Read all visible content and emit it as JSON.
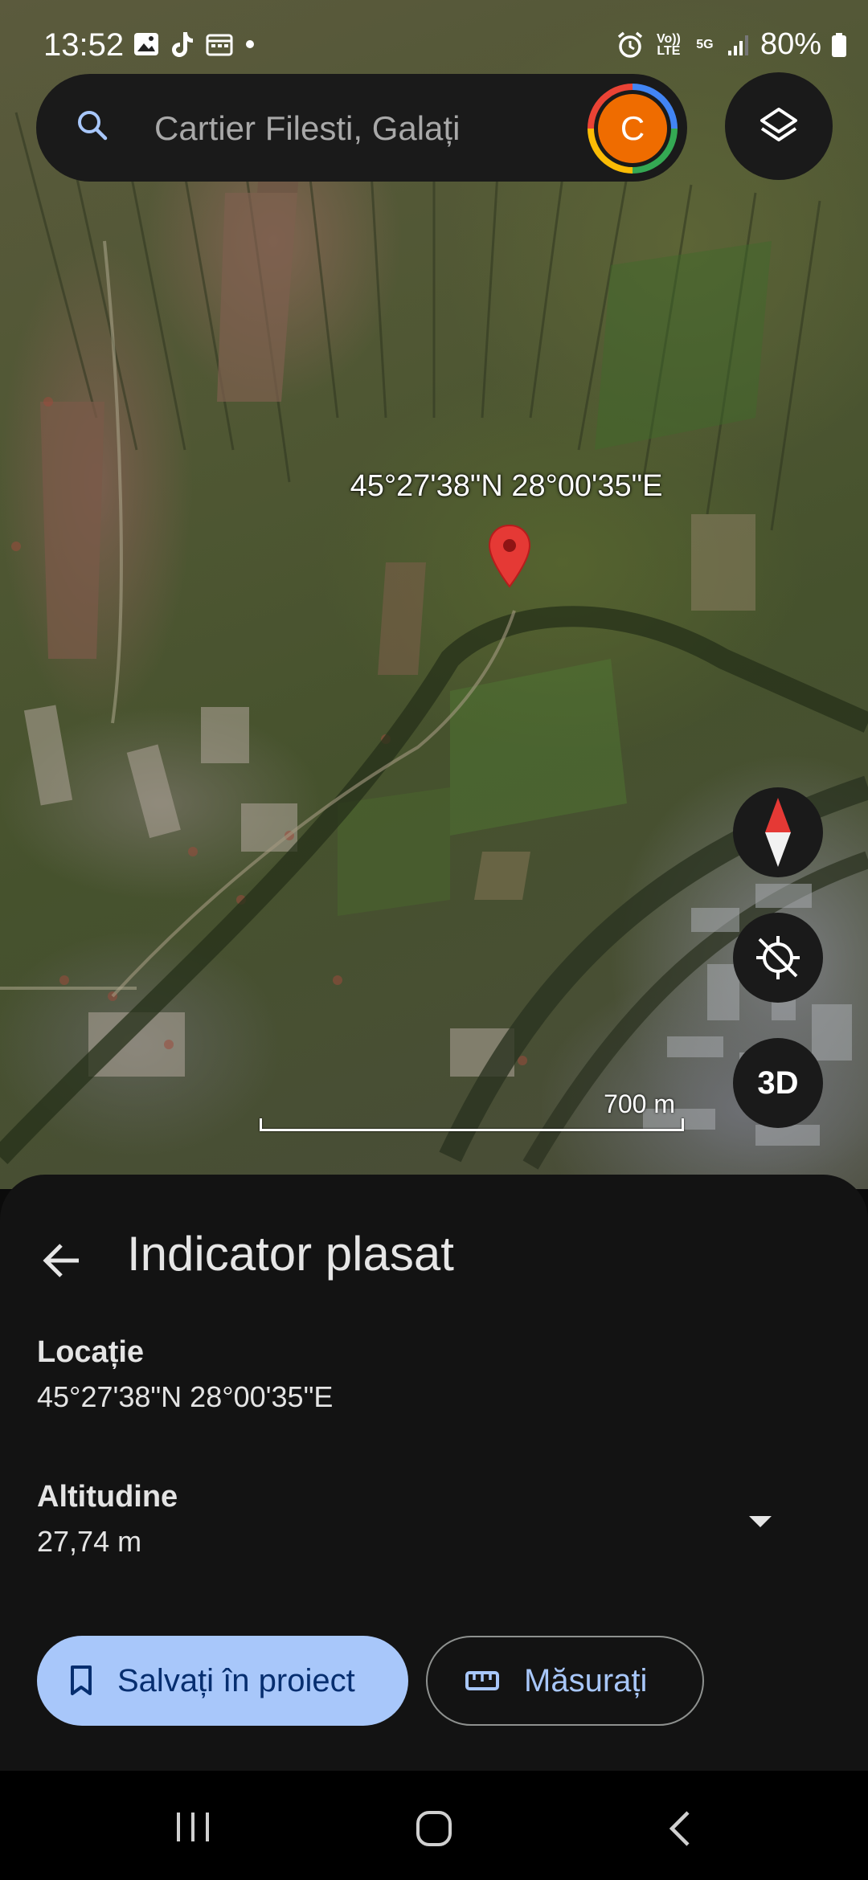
{
  "status_bar": {
    "time": "13:52",
    "battery": "80%",
    "volte": "Vo)) LTE",
    "network": "5G"
  },
  "search": {
    "placeholder": "Cartier Filesti, Galați",
    "avatar_letter": "C"
  },
  "map": {
    "pin_coordinates": "45°27'38\"N 28°00'35\"E",
    "scale_label": "700 m",
    "button_3d": "3D"
  },
  "sheet": {
    "title": "Indicator plasat",
    "location_label": "Locație",
    "location_value": "45°27'38\"N 28°00'35\"E",
    "altitude_label": "Altitudine",
    "altitude_value": "27,74 m",
    "save_button": "Salvați în proiect",
    "measure_button": "Măsurați"
  },
  "colors": {
    "sheet_bg": "#131313",
    "primary_button": "#a8c7fa",
    "primary_text": "#062e6f",
    "pin_red": "#e53935",
    "avatar_orange": "#ef6c00"
  },
  "icons": [
    "search-icon",
    "layers-icon",
    "compass-icon",
    "location-disabled-icon",
    "back-arrow-icon",
    "dropdown-icon",
    "bookmark-icon",
    "ruler-icon"
  ]
}
